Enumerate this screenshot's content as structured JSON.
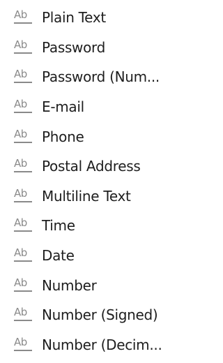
{
  "toolbox": {
    "items": [
      {
        "icon": "text-field-icon",
        "icon_text": "Ab",
        "label": "Plain Text"
      },
      {
        "icon": "text-field-icon",
        "icon_text": "Ab",
        "label": "Password"
      },
      {
        "icon": "text-field-icon",
        "icon_text": "Ab",
        "label": "Password (Num..."
      },
      {
        "icon": "text-field-icon",
        "icon_text": "Ab",
        "label": "E-mail"
      },
      {
        "icon": "text-field-icon",
        "icon_text": "Ab",
        "label": "Phone"
      },
      {
        "icon": "text-field-icon",
        "icon_text": "Ab",
        "label": "Postal Address"
      },
      {
        "icon": "text-field-icon",
        "icon_text": "Ab",
        "label": "Multiline Text"
      },
      {
        "icon": "text-field-icon",
        "icon_text": "Ab",
        "label": "Time"
      },
      {
        "icon": "text-field-icon",
        "icon_text": "Ab",
        "label": "Date"
      },
      {
        "icon": "text-field-icon",
        "icon_text": "Ab",
        "label": "Number"
      },
      {
        "icon": "text-field-icon",
        "icon_text": "Ab",
        "label": "Number (Signed)"
      },
      {
        "icon": "text-field-icon",
        "icon_text": "Ab",
        "label": "Number (Decim..."
      }
    ]
  },
  "colors": {
    "icon": "#8a8a8a",
    "label": "#1e1e1e",
    "background": "#ffffff"
  }
}
